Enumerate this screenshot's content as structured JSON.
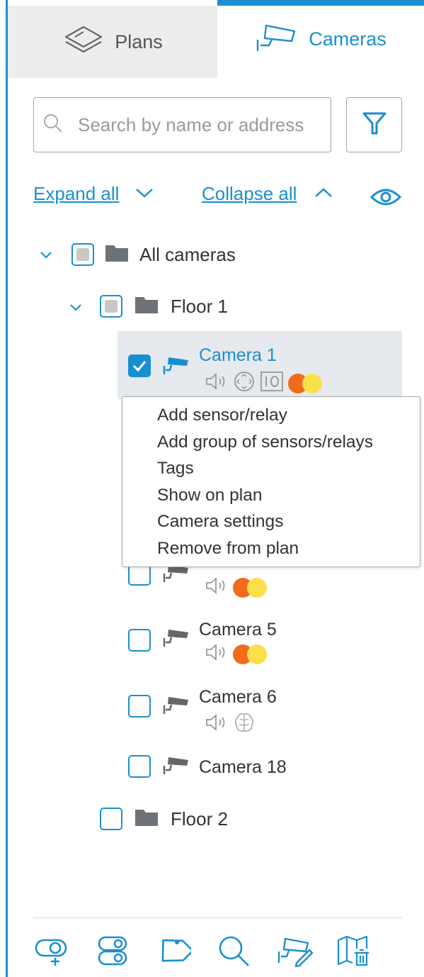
{
  "tabs": [
    {
      "label": "Plans",
      "icon": "layers-icon",
      "active": false
    },
    {
      "label": "Cameras",
      "icon": "camera-icon",
      "active": true
    }
  ],
  "search": {
    "placeholder": "Search by name or address",
    "value": ""
  },
  "toolbar_top": {
    "expand_all": "Expand all",
    "collapse_all": "Collapse all"
  },
  "tree": {
    "root": {
      "label": "All cameras",
      "state": "partial",
      "expanded": true
    },
    "floor1": {
      "label": "Floor 1",
      "state": "partial",
      "expanded": true
    },
    "floor2": {
      "label": "Floor 2",
      "state": "unchecked"
    },
    "cameras": [
      {
        "label": "Camera 1",
        "checked": true,
        "selected": true,
        "indicators": [
          "speaker-icon",
          "ptz-icon",
          "io-icon",
          "status-dots"
        ]
      },
      {
        "label": "",
        "checked": false,
        "indicators": [
          "speaker-icon",
          "status-dots"
        ]
      },
      {
        "label": "Camera 5",
        "checked": false,
        "indicators": [
          "speaker-icon",
          "status-dots"
        ]
      },
      {
        "label": "Camera 6",
        "checked": false,
        "indicators": [
          "speaker-icon",
          "brain-icon"
        ]
      },
      {
        "label": "Camera 18",
        "checked": false,
        "indicators": []
      }
    ]
  },
  "context_menu": {
    "items": [
      "Add sensor/relay",
      "Add group of sensors/relays",
      "Tags",
      "Show on plan",
      "Camera settings",
      "Remove from plan"
    ]
  },
  "bottom_toolbar": [
    "add-sensor-icon",
    "add-group-icon",
    "tag-icon",
    "search-icon",
    "camera-settings-icon",
    "remove-from-plan-icon"
  ],
  "colors": {
    "accent": "#1a8fd0",
    "orange": "#f26a1b",
    "yellow": "#fae04a",
    "selection": "#e6e9ee"
  }
}
